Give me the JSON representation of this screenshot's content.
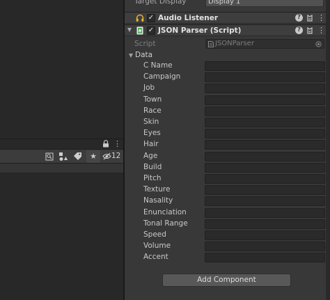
{
  "hierarchy_panel": {
    "toolbar_count": "12"
  },
  "camera": {
    "target_display_label": "Target Display",
    "target_display_value": "Display 1"
  },
  "audio_listener": {
    "title": "Audio Listener",
    "enabled": true
  },
  "json_parser": {
    "title": "JSON Parser (Script)",
    "enabled": true,
    "script_label": "Script",
    "script_value": "JSONParser",
    "data_label": "Data",
    "fields": [
      {
        "label": "C Name",
        "value": ""
      },
      {
        "label": "Campaign",
        "value": ""
      },
      {
        "label": "Job",
        "value": ""
      },
      {
        "label": "Town",
        "value": ""
      },
      {
        "label": "Race",
        "value": ""
      },
      {
        "label": "Skin",
        "value": ""
      },
      {
        "label": "Eyes",
        "value": ""
      },
      {
        "label": "Hair",
        "value": ""
      },
      {
        "label": "Age",
        "value": ""
      },
      {
        "label": "Build",
        "value": ""
      },
      {
        "label": "Pitch",
        "value": ""
      },
      {
        "label": "Texture",
        "value": ""
      },
      {
        "label": "Nasality",
        "value": ""
      },
      {
        "label": "Enunciation",
        "value": ""
      },
      {
        "label": "Tonal Range",
        "value": ""
      },
      {
        "label": "Speed",
        "value": ""
      },
      {
        "label": "Volume",
        "value": ""
      },
      {
        "label": "Accent",
        "value": ""
      }
    ]
  },
  "add_component_label": "Add Component",
  "icons": {
    "help": "?",
    "menu": "⋮",
    "check": "✓"
  },
  "colors": {
    "inspector_bg": "#383838",
    "field_bg": "#2a2a2a",
    "header_bg": "#3e3e3e",
    "script_icon": "#4caf50",
    "audio_icon": "#e8b431"
  }
}
